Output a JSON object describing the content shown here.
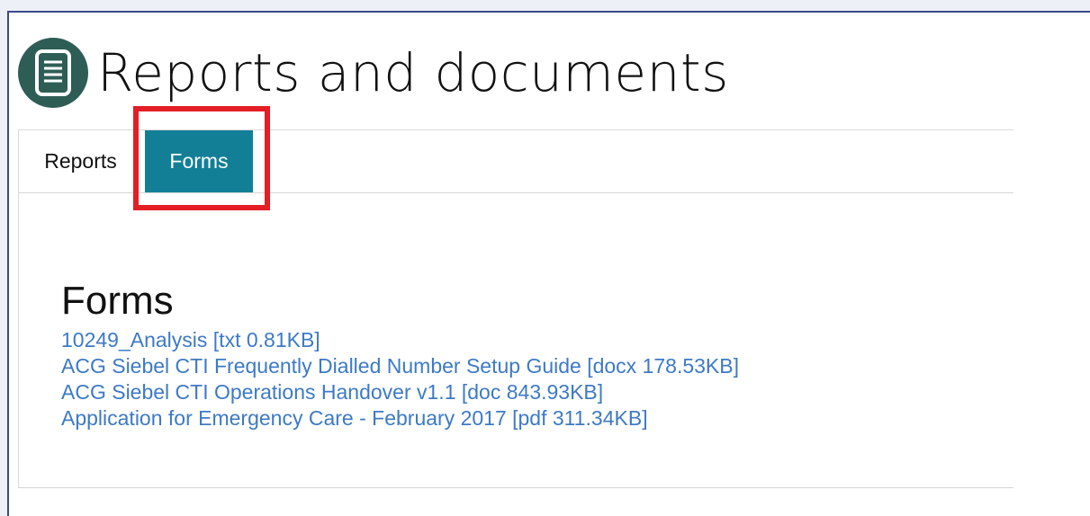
{
  "page": {
    "title": "Reports and documents",
    "logo_icon": "document-icon"
  },
  "tabs": [
    {
      "label": "Reports",
      "active": false
    },
    {
      "label": "Forms",
      "active": true
    }
  ],
  "forms_section": {
    "heading": "Forms",
    "documents": [
      {
        "label": "10249_Analysis [txt 0.81KB]"
      },
      {
        "label": "ACG Siebel CTI Frequently Dialled Number Setup Guide [docx 178.53KB]"
      },
      {
        "label": "ACG Siebel CTI Operations Handover v1.1 [doc 843.93KB]"
      },
      {
        "label": "Application for Emergency Care - February 2017 [pdf 311.34KB]"
      }
    ]
  },
  "colors": {
    "active_tab": "#137f97",
    "highlight": "#e31e24",
    "link": "#3d7ac5",
    "logo": "#2e5d56"
  }
}
